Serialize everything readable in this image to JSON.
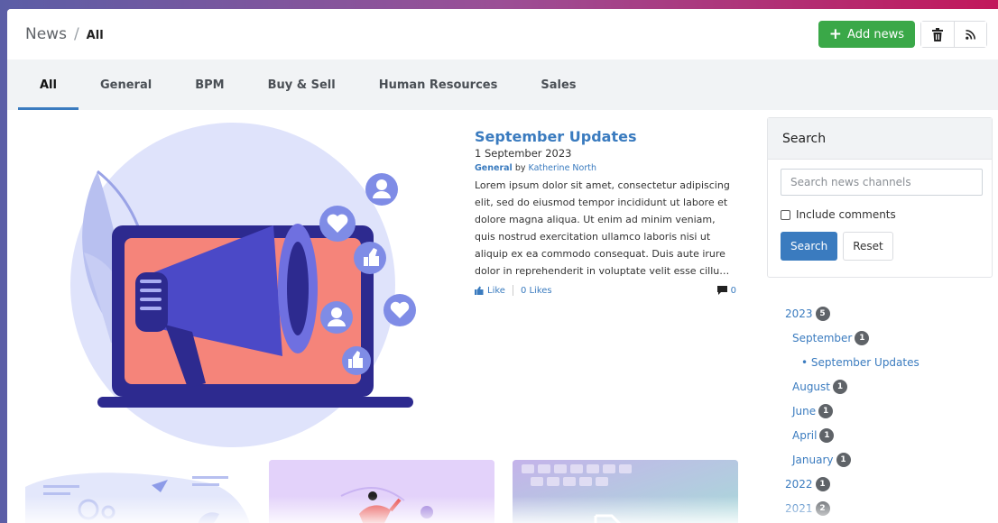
{
  "breadcrumb": {
    "root": "News",
    "separator": "/",
    "current": "All"
  },
  "header_actions": {
    "add_news_label": "Add news",
    "add_icon": "plus-icon",
    "delete_icon": "trash-icon",
    "rss_icon": "rss-icon"
  },
  "tabs": [
    {
      "label": "All",
      "active": true
    },
    {
      "label": "General"
    },
    {
      "label": "BPM"
    },
    {
      "label": "Buy & Sell"
    },
    {
      "label": "Human Resources"
    },
    {
      "label": "Sales"
    }
  ],
  "article": {
    "title": "September Updates",
    "date": "1 September 2023",
    "category": "General",
    "by": "by",
    "author": "Katherine North",
    "excerpt": "Lorem ipsum dolor sit amet, consectetur adipiscing elit, sed do eiusmod tempor incididunt ut labore et dolore magna aliqua. Ut enim ad minim veniam, quis nostrud exercitation ullamco laboris nisi ut aliquip ex ea commodo consequat. Duis aute irure dolor in reprehenderit in voluptate velit esse cillu…",
    "like_label": "Like",
    "likes_label": "0 Likes",
    "comments_count": "0"
  },
  "search": {
    "heading": "Search",
    "placeholder": "Search news channels",
    "include_comments_label": "Include comments",
    "search_button": "Search",
    "reset_button": "Reset"
  },
  "archive": {
    "year_2023": {
      "label": "2023",
      "count": "5"
    },
    "september": {
      "label": "September",
      "count": "1"
    },
    "september_post": "• September Updates",
    "august": {
      "label": "August",
      "count": "1"
    },
    "june": {
      "label": "June",
      "count": "1"
    },
    "april": {
      "label": "April",
      "count": "1"
    },
    "january": {
      "label": "January",
      "count": "1"
    },
    "year_2022": {
      "label": "2022",
      "count": "1"
    },
    "year_2021": {
      "label": "2021",
      "count": "2"
    }
  },
  "colors": {
    "accent": "#3a7bbf",
    "add_button": "#3aa848",
    "badge": "#5f6368"
  }
}
